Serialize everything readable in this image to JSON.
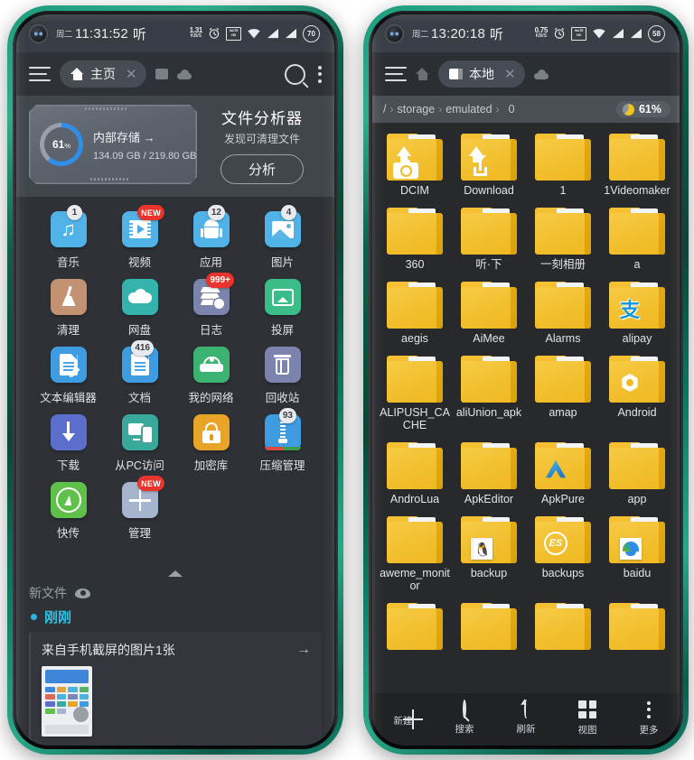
{
  "left_phone": {
    "status_bar": {
      "day": "周二",
      "time": "11:31:52",
      "listen_icon_text": "听",
      "net_speed_value": "1.31",
      "net_speed_unit": "KB/S",
      "signal_type": "VoLTE",
      "battery": "70"
    },
    "toolbar": {
      "menu_icon": "hamburger-icon",
      "tab_label": "主页",
      "tab_close": "✕",
      "search_icon": "search-icon",
      "more_icon": "kebab-menu-icon"
    },
    "storage": {
      "percent_label": "61",
      "percent_unit": "%",
      "percent_value": 61,
      "title": "内部存储 →",
      "usage": "134.09 GB / 219.80 GB",
      "analyzer_title": "文件分析器",
      "analyzer_sub": "发现可清理文件",
      "analyzer_button": "分析"
    },
    "apps": [
      {
        "label": "音乐",
        "icon": "music-icon",
        "color": "#51b2e8",
        "badge": "1",
        "badge_style": "light"
      },
      {
        "label": "视频",
        "icon": "video-icon",
        "color": "#51b2e8",
        "badge": "NEW",
        "badge_style": "new"
      },
      {
        "label": "应用",
        "icon": "android-apps-icon",
        "color": "#51b2e8",
        "badge": "12",
        "badge_style": "light"
      },
      {
        "label": "图片",
        "icon": "picture-icon",
        "color": "#51b2e8",
        "badge": "4",
        "badge_style": "light"
      },
      {
        "label": "清理",
        "icon": "broom-clean-icon",
        "color": "#c29273",
        "badge": "",
        "badge_style": ""
      },
      {
        "label": "网盘",
        "icon": "cloud-drive-icon",
        "color": "#34b3ac",
        "badge": "",
        "badge_style": ""
      },
      {
        "label": "日志",
        "icon": "logs-stack-icon",
        "color": "#7c84ad",
        "badge": "999+",
        "badge_style": "red"
      },
      {
        "label": "投屏",
        "icon": "cast-screen-icon",
        "color": "#3bbd8a",
        "badge": "",
        "badge_style": ""
      },
      {
        "label": "文本编辑器",
        "icon": "text-editor-icon",
        "color": "#3f9ce0",
        "badge": "",
        "badge_style": ""
      },
      {
        "label": "文档",
        "icon": "document-icon",
        "color": "#3f9ce0",
        "badge": "416",
        "badge_style": "light"
      },
      {
        "label": "我的网络",
        "icon": "router-network-icon",
        "color": "#3cb371",
        "badge": "",
        "badge_style": ""
      },
      {
        "label": "回收站",
        "icon": "trash-icon",
        "color": "#7c84ad",
        "badge": "",
        "badge_style": ""
      },
      {
        "label": "下载",
        "icon": "download-icon",
        "color": "#5b6ecb",
        "badge": "",
        "badge_style": ""
      },
      {
        "label": "从PC访问",
        "icon": "pc-access-icon",
        "color": "#3aa99d",
        "badge": "",
        "badge_style": ""
      },
      {
        "label": "加密库",
        "icon": "lock-vault-icon",
        "color": "#e8a427",
        "badge": "",
        "badge_style": ""
      },
      {
        "label": "压缩管理",
        "icon": "zip-archive-icon",
        "color": "#3f9ce0",
        "badge": "93",
        "badge_style": "light"
      },
      {
        "label": "快传",
        "icon": "fast-transfer-icon",
        "color": "#5fc04a",
        "badge": "",
        "badge_style": ""
      },
      {
        "label": "管理",
        "icon": "add-manage-icon",
        "color": "#a7b4cd",
        "badge": "NEW",
        "badge_style": "new"
      }
    ],
    "collapse_icon": "chevron-up-icon",
    "new_files": {
      "label": "新文件",
      "eye_icon": "eye-icon"
    },
    "recent": {
      "time_label": "刚刚",
      "item_text": "来自手机截屏的图片1张",
      "arrow": "→"
    }
  },
  "right_phone": {
    "status_bar": {
      "day": "周二",
      "time": "13:20:18",
      "listen_icon_text": "听",
      "net_speed_value": "0.75",
      "net_speed_unit": "KB/S",
      "signal_type": "VoLTE",
      "battery": "58"
    },
    "toolbar": {
      "menu_icon": "hamburger-icon",
      "home_icon": "home-icon",
      "tab_label": "本地",
      "tab_close": "✕",
      "cloud_icon": "cloud-icon"
    },
    "path_bar": {
      "root": "/",
      "segments": [
        "storage",
        "emulated",
        "0"
      ],
      "separator": "›",
      "storage_pill": "61%",
      "pie_icon": "pie-chart-icon"
    },
    "folders": [
      {
        "name": "DCIM",
        "emblem": "camera-upload-emblem"
      },
      {
        "name": "Download",
        "emblem": "download-upload-emblem"
      },
      {
        "name": "1",
        "emblem": ""
      },
      {
        "name": "1Videomaker",
        "emblem": ""
      },
      {
        "name": "360",
        "emblem": ""
      },
      {
        "name": "听·下",
        "emblem": ""
      },
      {
        "name": "一刻相册",
        "emblem": ""
      },
      {
        "name": "a",
        "emblem": ""
      },
      {
        "name": "aegis",
        "emblem": ""
      },
      {
        "name": "AiMee",
        "emblem": ""
      },
      {
        "name": "Alarms",
        "emblem": ""
      },
      {
        "name": "alipay",
        "emblem": "alipay-emblem"
      },
      {
        "name": "ALIPUSH_CACHE",
        "emblem": ""
      },
      {
        "name": "aliUnion_apk",
        "emblem": ""
      },
      {
        "name": "amap",
        "emblem": ""
      },
      {
        "name": "Android",
        "emblem": "android-nut-emblem"
      },
      {
        "name": "AndroLua",
        "emblem": ""
      },
      {
        "name": "ApkEditor",
        "emblem": ""
      },
      {
        "name": "ApkPure",
        "emblem": "apkpure-emblem"
      },
      {
        "name": "app",
        "emblem": ""
      },
      {
        "name": "aweme_monitor",
        "emblem": ""
      },
      {
        "name": "backup",
        "emblem": "qq-emblem"
      },
      {
        "name": "backups",
        "emblem": "es-emblem"
      },
      {
        "name": "baidu",
        "emblem": "baidu-emblem"
      },
      {
        "name": "",
        "emblem": ""
      },
      {
        "name": "",
        "emblem": ""
      },
      {
        "name": "",
        "emblem": ""
      },
      {
        "name": "",
        "emblem": ""
      }
    ],
    "bottom_bar": [
      {
        "label": "新建",
        "icon": "plus-icon"
      },
      {
        "label": "搜索",
        "icon": "search-icon"
      },
      {
        "label": "刷新",
        "icon": "refresh-icon"
      },
      {
        "label": "视图",
        "icon": "grid-view-icon"
      },
      {
        "label": "更多",
        "icon": "kebab-menu-icon"
      }
    ]
  },
  "theme": {
    "frame_color": "#14836b",
    "screen_bg": "#2e3238",
    "accent_blue": "#2f8fe8",
    "folder_yellow": "#f2bf2e",
    "badge_red": "#e8342c",
    "cyan_text": "#2ec0e0"
  }
}
